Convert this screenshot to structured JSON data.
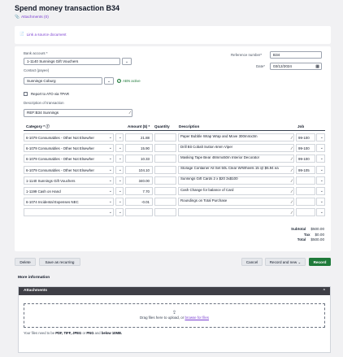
{
  "header": {
    "title": "Spend money transaction B34",
    "attachments_link": "Attachments (0)"
  },
  "source_link": "Link a source document",
  "form": {
    "bank_account_label": "Bank account *",
    "bank_account_value": "1-1140  Sunnings Gift Vouchers",
    "contact_label": "Contact (payee)",
    "contact_value": "Sunnings Coburg",
    "abn_status": "ABN active",
    "report_ato_label": "Report to ATO via TPAR",
    "description_label": "Description of transaction",
    "description_value": "REF:B34 Sunnings",
    "reference_label": "Reference number*",
    "reference_value": "B34",
    "date_label": "Date*",
    "date_value": "03/12/2024"
  },
  "table": {
    "headers": {
      "category": "Category *",
      "amount": "Amount ($) *",
      "quantity": "Quantity",
      "description": "Description",
      "job": "Job"
    },
    "rows": [
      {
        "category": "6-1079   Consumables - Other Not Elsewher",
        "amount": "21.88",
        "quantity": "",
        "description": "Paper Bubble Wrap Wrap and Move 300mmx3m",
        "job": "99-100"
      },
      {
        "category": "6-1079   Consumables - Other Not Elsewher",
        "amount": "15.90",
        "quantity": "",
        "description": "Drill Bit Cobalt Sutton 6mm Viper",
        "job": "99-100"
      },
      {
        "category": "6-1079   Consumables - Other Not Elsewher",
        "amount": "10.33",
        "quantity": "",
        "description": "Masking Tape Bear 48mmx50m Interior Decorator",
        "job": "99-100"
      },
      {
        "category": "6-1079   Consumables - Other Not Elsewher",
        "amount": "104.10",
        "quantity": "",
        "description": "Storage Container All Set 50L Clear W/Wheels 15 @ $6.94 ea",
        "job": "99-105"
      },
      {
        "category": "1-1140   Sunnings Gift Vouchers",
        "amount": "340.00",
        "quantity": "",
        "description": "Sunnings Gift Cards 2 x $20 3x$100",
        "job": ""
      },
      {
        "category": "1-1199   Cash on Hand",
        "amount": "7.70",
        "quantity": "",
        "description": "Cash Change for balance of Card",
        "job": ""
      },
      {
        "category": "6-1074   Incidental Expenses NEC",
        "amount": "-0.01",
        "quantity": "",
        "description": "Roundings on Total Purchase",
        "job": ""
      },
      {
        "category": "",
        "amount": "",
        "quantity": "",
        "description": "",
        "job": ""
      }
    ]
  },
  "totals": {
    "subtotal_label": "Subtotal",
    "subtotal_value": "$500.00",
    "tax_label": "Tax",
    "tax_value": "$0.00",
    "total_label": "Total",
    "total_value": "$500.00"
  },
  "actions": {
    "delete": "Delete",
    "save_recurring": "Save as recurring",
    "cancel": "Cancel",
    "record_new": "Record and new",
    "record": "Record"
  },
  "more_information": "More information",
  "attachments_panel": {
    "title": "Attachments",
    "drop_text": "Drag files here to upload, or",
    "browse": "browse for files",
    "types_prefix": "Your files need to be",
    "types": "PDF, TIFF, JPEG",
    "types_or": "or",
    "types_png": "PNG",
    "types_and": "and",
    "types_size": "below 10MB."
  }
}
